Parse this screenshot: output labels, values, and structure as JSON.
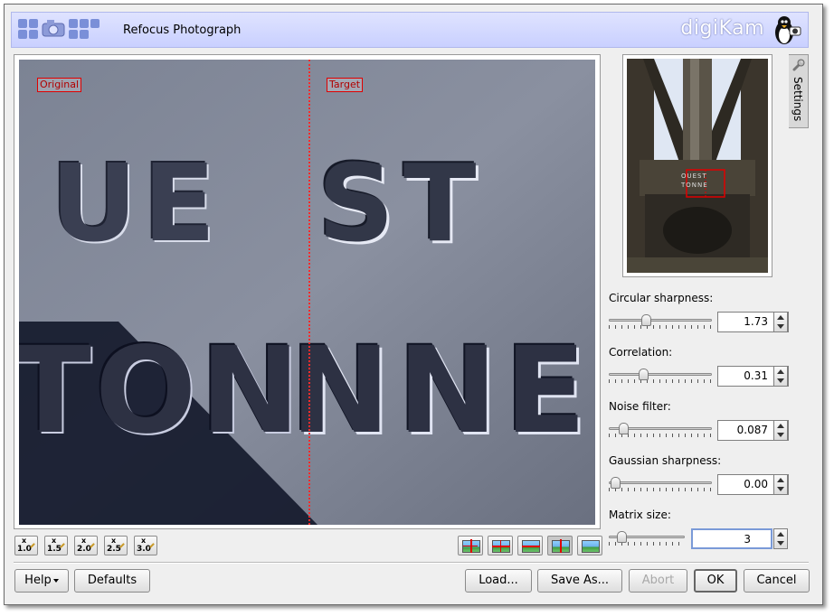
{
  "header": {
    "title": "Refocus Photograph",
    "brand": "digiKam"
  },
  "preview": {
    "original_label": "Original",
    "target_label": "Target",
    "photo_text_top_left": "UE",
    "photo_text_top_right": "ST",
    "photo_text_bottom_left": "TON",
    "photo_text_bottom_right": "NNE"
  },
  "zoom_buttons": [
    {
      "mark": "x",
      "value": "1.0"
    },
    {
      "mark": "x",
      "value": "1.5"
    },
    {
      "mark": "x",
      "value": "2.0"
    },
    {
      "mark": "x",
      "value": "2.5"
    },
    {
      "mark": "x",
      "value": "3.0"
    }
  ],
  "view_buttons": [
    {
      "icon": "separate-vertical-duplicate-icon",
      "active": false
    },
    {
      "icon": "separate-horizontal-duplicate-icon",
      "active": false
    },
    {
      "icon": "separate-vertical-icon",
      "active": false
    },
    {
      "icon": "separate-horizontal-icon",
      "active": true
    },
    {
      "icon": "no-separation-icon",
      "active": false
    }
  ],
  "sidebar": {
    "tab_label": "Settings",
    "tab_icon": "wrench-icon",
    "thumbnail_text": "OUEST TONNE"
  },
  "settings": {
    "circular_sharpness": {
      "label": "Circular sharpness:",
      "value": "1.73",
      "level": 0.34
    },
    "correlation": {
      "label": "Correlation:",
      "value": "0.31",
      "level": 0.31
    },
    "noise_filter": {
      "label": "Noise filter:",
      "value": "0.087",
      "level": 0.09
    },
    "gaussian_sharpness": {
      "label": "Gaussian sharpness:",
      "value": "0.00",
      "level": 0.0
    },
    "matrix_size": {
      "label": "Matrix size:",
      "value": "3",
      "level": 0.1
    }
  },
  "buttons": {
    "help": "Help",
    "defaults": "Defaults",
    "load": "Load...",
    "save_as": "Save As...",
    "abort": "Abort",
    "ok": "OK",
    "cancel": "Cancel"
  },
  "colors": {
    "banner": "#c9d0ff",
    "divider": "#ff2b2b",
    "focus": "#7a9ad8"
  }
}
